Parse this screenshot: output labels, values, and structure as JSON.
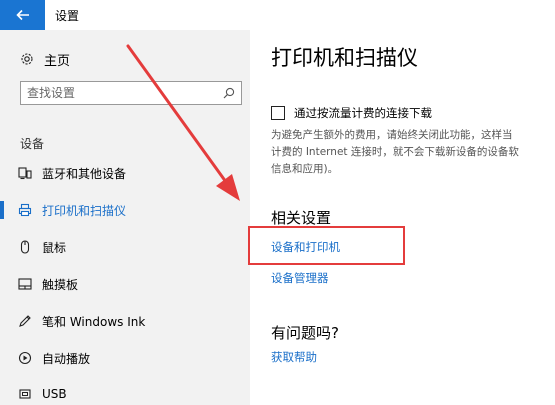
{
  "window": {
    "title": "设置"
  },
  "sidebar": {
    "home_label": "主页",
    "search_placeholder": "查找设置",
    "section_label": "设备",
    "items": [
      {
        "label": "蓝牙和其他设备",
        "icon": "bluetooth-devices-icon"
      },
      {
        "label": "打印机和扫描仪",
        "icon": "printer-icon",
        "active": true
      },
      {
        "label": "鼠标",
        "icon": "mouse-icon"
      },
      {
        "label": "触摸板",
        "icon": "touchpad-icon"
      },
      {
        "label": "笔和 Windows Ink",
        "icon": "pen-icon"
      },
      {
        "label": "自动播放",
        "icon": "autoplay-icon"
      },
      {
        "label": "USB",
        "icon": "usb-icon"
      }
    ]
  },
  "main": {
    "title": "打印机和扫描仪",
    "metered_checkbox_label": "通过按流量计费的连接下载",
    "metered_checked": false,
    "description_lines": [
      "为避免产生额外的费用，请始终关闭此功能，这样当",
      "计费的 Internet 连接时，就不会下载新设备的设备软",
      "信息和应用)。"
    ],
    "related_title": "相关设置",
    "related_links": [
      "设备和打印机",
      "设备管理器"
    ],
    "help_title": "有问题吗?",
    "help_link": "获取帮助"
  },
  "colors": {
    "accent": "#1a6fc9",
    "back_button": "#1a75d2",
    "annotation": "#e43c3c",
    "sidebar_bg": "#f2f2f2"
  }
}
